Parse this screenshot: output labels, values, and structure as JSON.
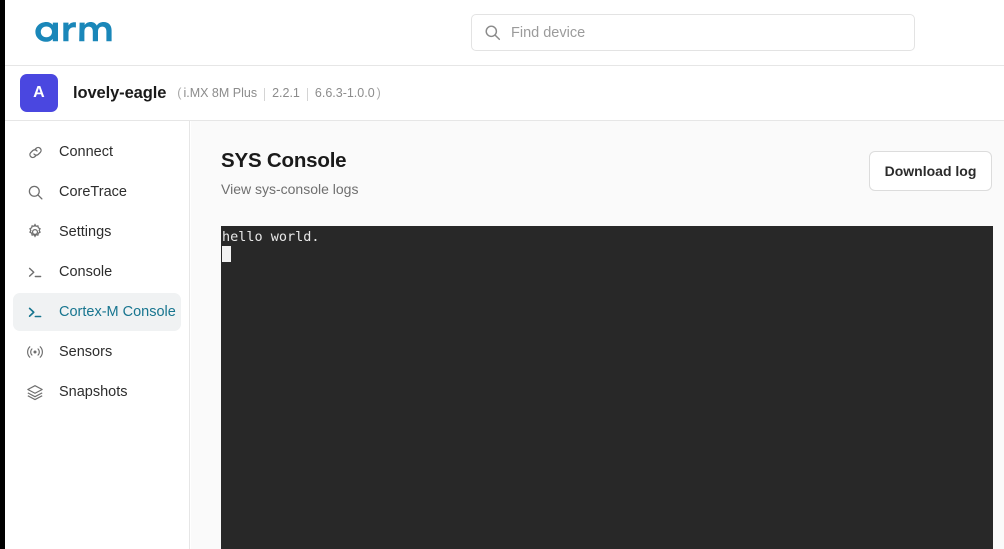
{
  "brand": {
    "logo_text": "arm",
    "logo_color": "#1a87b9"
  },
  "header": {
    "search": {
      "placeholder": "Find device",
      "value": "",
      "icon": "search-icon"
    }
  },
  "device_bar": {
    "avatar_initial": "A",
    "avatar_color": "#4a47e0",
    "name": "lovely-eagle",
    "meta": {
      "open_paren": "(",
      "platform": "i.MX 8M Plus",
      "version": "2.2.1",
      "build": "6.6.3-1.0.0",
      "close_paren": ")"
    }
  },
  "sidebar": {
    "items": [
      {
        "label": "Connect",
        "icon": "link-icon",
        "active": false
      },
      {
        "label": "CoreTrace",
        "icon": "search-icon",
        "active": false
      },
      {
        "label": "Settings",
        "icon": "gear-icon",
        "active": false
      },
      {
        "label": "Console",
        "icon": "terminal-icon",
        "active": false
      },
      {
        "label": "Cortex-M Console",
        "icon": "terminal-icon",
        "active": true
      },
      {
        "label": "Sensors",
        "icon": "signal-icon",
        "active": false
      },
      {
        "label": "Snapshots",
        "icon": "layers-icon",
        "active": false
      }
    ],
    "active_color": "#17758f",
    "active_bg": "#f0f2f3"
  },
  "main": {
    "title": "SYS Console",
    "subtitle": "View sys-console logs",
    "download_button": "Download log",
    "terminal": {
      "background": "#282828",
      "text_color": "#e8e8e8",
      "lines": [
        "hello world."
      ],
      "cursor_visible": true
    }
  }
}
